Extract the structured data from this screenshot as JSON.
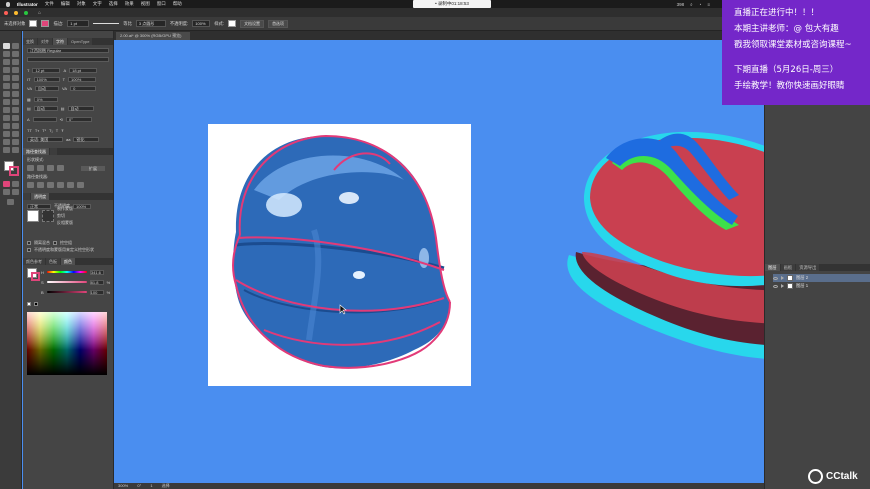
{
  "menubar": {
    "app_name": "Illustrator",
    "menus": [
      "文件",
      "编辑",
      "对象",
      "文字",
      "选择",
      "效果",
      "视图",
      "窗口",
      "帮助"
    ],
    "recording_label": "• 录制中01:18:53",
    "battery": "398",
    "search_icon": "magnifier-icon"
  },
  "control_bar": {
    "mode_label": "未选择对象",
    "stroke_label": "描边:",
    "stroke_width": "1 pt",
    "profile_label": "等比",
    "brush_label": "3 点圆形",
    "opacity_label": "不透明度:",
    "opacity_value": "100%",
    "style_label": "样式:",
    "doc_setup_button": "文档设置",
    "prefs_button": "首选项"
  },
  "document_tab": {
    "label": "2.00.ai* @ 300% (RGB/GPU 预览)"
  },
  "left_panel": {
    "tabs": [
      "变换",
      "对齐",
      "字符",
      "OpenType"
    ],
    "font_name": "江西拙楷 Regular",
    "font_size": "12 pt",
    "leading": "18 pt",
    "scale_h": "100%",
    "scale_v": "100%",
    "tracking_auto": "自动",
    "kerning": "0",
    "baseline": "0%",
    "auto_label": "自动",
    "rotate": "0°",
    "language": "英语: 美国",
    "sharpness": "锐化",
    "pathfinder_tab": "路径查找器",
    "transparency_tab": "透明度",
    "shape_modes_label": "形状模式:",
    "expand_button": "扩展",
    "pathfinder_label": "路径查找器:",
    "blend_mode": "正常",
    "opacity_label": "不透明度",
    "opacity_value": "100%",
    "make_mask_button": "制作蒙版",
    "clip_label": "剪切",
    "invert_label": "反相蒙版",
    "isolate_blend": "隔离混合",
    "knockout_group": "挖空组",
    "mask_opacity_label": "不透明度和蒙版用来定义挖空形状",
    "color_tabs": [
      "颜色参考",
      "色板",
      "颜色"
    ],
    "h_value": "341.6",
    "s_value": "81.8",
    "b_value": "100",
    "pct": "%"
  },
  "right_panel": {
    "tabs": [
      "图层",
      "画板",
      "资源导出"
    ],
    "layers": [
      {
        "name": "图层 2",
        "selected": true
      },
      {
        "name": "图层 1",
        "selected": false
      }
    ]
  },
  "status_bar": {
    "zoom": "300%",
    "angle": "0°",
    "artboard": "1",
    "tool": "选择"
  },
  "promo": {
    "line1": "直播正在进行中！！！",
    "line2": "本期主讲老师：@ 包大有趣",
    "line3": "戳我领取课堂素材或咨询课程~",
    "line4": "下期直播（5月26日-周三）",
    "line5": "手绘教学！教你快速画好眼睛"
  },
  "watermark": {
    "brand": "CCtalk"
  },
  "colors": {
    "canvas_bg": "#4a8ef0",
    "helmet_red": "#c94050",
    "helmet_dark": "#5a2230",
    "helmet_stripe": "#28d7ec",
    "helmet_green": "#3de14a",
    "helmet_blue": "#1e6ce0",
    "outline_pink": "#e23a78",
    "promo_bg": "#7427c9"
  }
}
